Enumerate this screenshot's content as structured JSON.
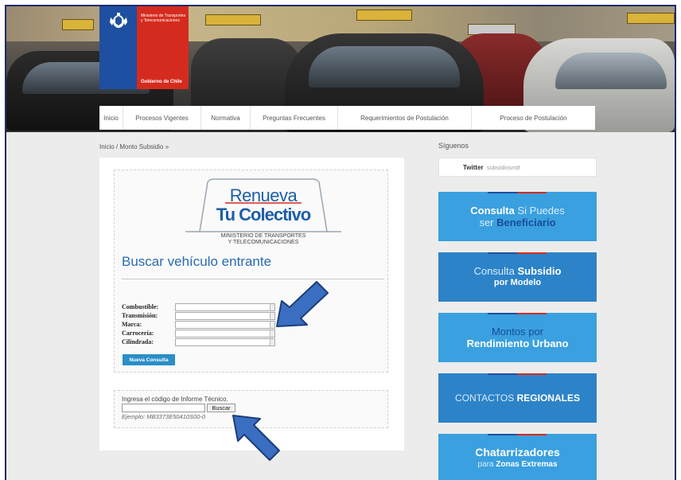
{
  "header": {
    "logo": {
      "ministry_text": "Ministerio de Transportes y Telecomunicaciones",
      "government_text": "Gobierno de Chile"
    }
  },
  "nav": {
    "items": [
      {
        "label": "Inicio"
      },
      {
        "label": "Procesos Vigentes"
      },
      {
        "label": "Normativa"
      },
      {
        "label": "Preguntas Frecuentes"
      },
      {
        "label": "Requerimientos de Postulación"
      },
      {
        "label": "Proceso de Postulación"
      }
    ]
  },
  "breadcrumb": "Inicio / Monto Subsidio »",
  "brand": {
    "line1": "Renueva",
    "line2": "Tu Colectivo",
    "sub1": "MINISTERIO DE TRANSPORTES",
    "sub2": "Y TELECOMUNICACIONES"
  },
  "search": {
    "title": "Buscar vehículo entrante",
    "fields": [
      {
        "label": "Combustible:"
      },
      {
        "label": "Transmisión:"
      },
      {
        "label": "Marca:"
      },
      {
        "label": "Carrocería:"
      },
      {
        "label": "Cilindrada:"
      }
    ],
    "button": "Nueva Consulta"
  },
  "code_search": {
    "label": "Ingresa el código de Informe Técnico.",
    "value": "",
    "button": "Buscar",
    "example": "Ejemplo: MB3373E50410S00-0"
  },
  "sidebar": {
    "title": "Síguenos",
    "twitter_label": "Twitter",
    "twitter_handle": "subsidiosmtt",
    "buttons": [
      {
        "l1a": "Consulta",
        "l1b": "Si Puedes",
        "l2a": "ser",
        "l2b": "Beneficiario"
      },
      {
        "l1a": "Consulta",
        "l1b": "Subsidio",
        "l2a": "por Modelo"
      },
      {
        "l1a": "Montos por",
        "l2a": "Rendimiento Urbano"
      },
      {
        "l1a": "CONTACTOS",
        "l1b": "REGIONALES"
      },
      {
        "l1a": "Chatarrizadores",
        "l2a": "para",
        "l2b": "Zonas Extremas"
      }
    ]
  },
  "colors": {
    "accent_blue": "#3aa0df",
    "title_blue": "#2a6bb0",
    "arrow_fill": "#3a6ec0",
    "flag_red": "#d52b1e",
    "flag_blue": "#1f4fa0"
  }
}
